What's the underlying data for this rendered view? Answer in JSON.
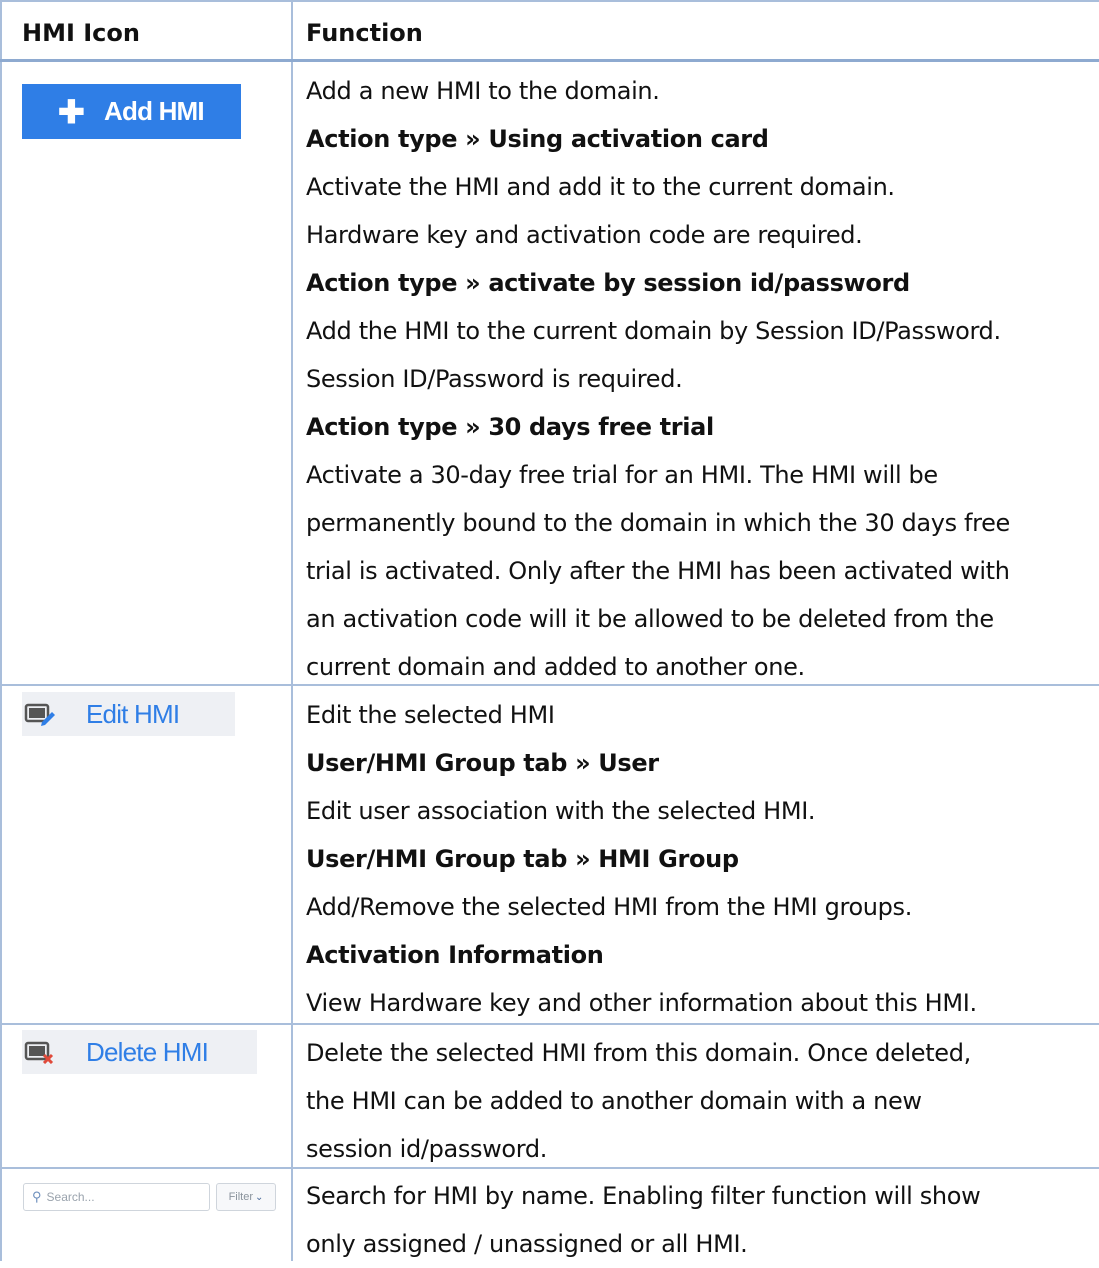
{
  "header": {
    "col1": "HMI Icon",
    "col2": "Function"
  },
  "rows": [
    {
      "icon": {
        "type": "add-button",
        "label": "Add HMI",
        "color": "#2f7ee6"
      },
      "lines": [
        {
          "text": "Add a new HMI to the domain.",
          "bold": false
        },
        {
          "text": "Action type » Using activation card",
          "bold": true
        },
        {
          "text": "Activate the HMI and add it to the current domain.",
          "bold": false
        },
        {
          "text": "Hardware key and activation code are required.",
          "bold": false
        },
        {
          "text": "Action type » activate by session id/password",
          "bold": true
        },
        {
          "text": "Add the HMI to the current domain by Session ID/Password.",
          "bold": false
        },
        {
          "text": "Session ID/Password is required.",
          "bold": false
        },
        {
          "text": "Action type » 30 days free trial",
          "bold": true
        },
        {
          "text": "Activate a 30-day free trial for an HMI. The HMI will be",
          "bold": false
        },
        {
          "text": "permanently bound to the domain in which the 30 days free",
          "bold": false
        },
        {
          "text": "trial is activated. Only after the HMI has been activated with",
          "bold": false
        },
        {
          "text": "an activation code will it be allowed to be deleted from the",
          "bold": false
        },
        {
          "text": "current domain and added to another one.",
          "bold": false
        }
      ]
    },
    {
      "icon": {
        "type": "edit-button",
        "label": "Edit HMI",
        "icon_name": "edit-hmi-icon"
      },
      "lines": [
        {
          "text": "Edit the selected HMI",
          "bold": false
        },
        {
          "text": "User/HMI Group tab » User",
          "bold": true
        },
        {
          "text": "Edit user association with the selected HMI.",
          "bold": false
        },
        {
          "text": "User/HMI Group tab » HMI Group",
          "bold": true
        },
        {
          "text": "Add/Remove the selected HMI from the HMI groups.",
          "bold": false
        },
        {
          "text": "Activation Information",
          "bold": true
        },
        {
          "text": "View Hardware key and other information about this HMI.",
          "bold": false
        }
      ]
    },
    {
      "icon": {
        "type": "delete-button",
        "label": "Delete HMI",
        "icon_name": "delete-hmi-icon"
      },
      "lines": [
        {
          "text": "Delete the selected HMI from this domain. Once deleted,",
          "bold": false
        },
        {
          "text": "the HMI can be added to another domain with a new",
          "bold": false
        },
        {
          "text": "session id/password.",
          "bold": false
        }
      ]
    },
    {
      "icon": {
        "type": "search-filter",
        "search_placeholder": "Search...",
        "filter_label": "Filter"
      },
      "lines": [
        {
          "text": "Search for HMI by name. Enabling filter function will show",
          "bold": false
        },
        {
          "text": "only assigned / unassigned or all HMI.",
          "bold": false
        }
      ]
    }
  ]
}
